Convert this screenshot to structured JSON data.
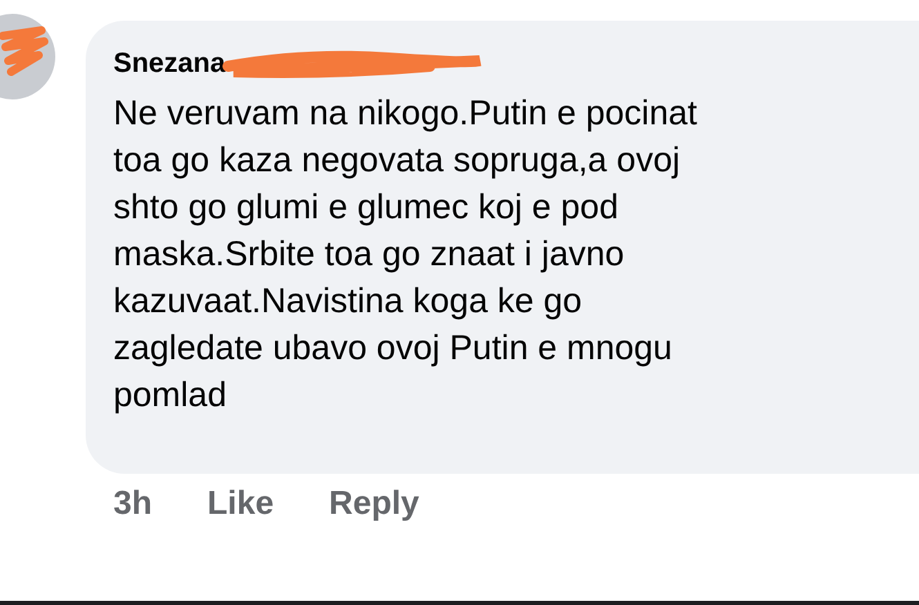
{
  "comment": {
    "author": "Snezana",
    "text": "Ne veruvam na nikogo.Putin e pocinat\ntoa go kaza negovata sopruga,a ovoj\nshto go glumi e glumec koj e pod\nmaska.Srbite toa go znaat i javno\nkazuvaat.Navistina koga ke go\nzagledate ubavo ovoj Putin e mnogu\npomlad",
    "time": "3h",
    "actions": [
      "Like",
      "Reply"
    ]
  }
}
